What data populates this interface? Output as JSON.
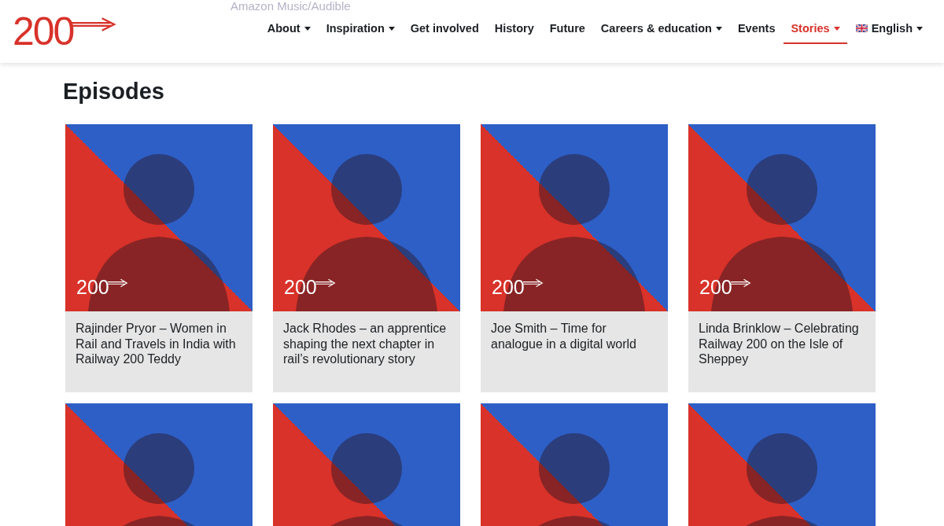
{
  "behind_header": {
    "label": "Amazon Music/Audible"
  },
  "logo": {
    "text": "200"
  },
  "nav": [
    {
      "label": "About",
      "dropdown": true,
      "selected": false,
      "kind": "link"
    },
    {
      "label": "Inspiration",
      "dropdown": true,
      "selected": false,
      "kind": "link"
    },
    {
      "label": "Get involved",
      "dropdown": false,
      "selected": false,
      "kind": "link"
    },
    {
      "label": "History",
      "dropdown": false,
      "selected": false,
      "kind": "link"
    },
    {
      "label": "Future",
      "dropdown": false,
      "selected": false,
      "kind": "link"
    },
    {
      "label": "Careers & education",
      "dropdown": true,
      "selected": false,
      "kind": "link"
    },
    {
      "label": "Events",
      "dropdown": false,
      "selected": false,
      "kind": "link"
    },
    {
      "label": "Stories",
      "dropdown": true,
      "selected": true,
      "kind": "link"
    },
    {
      "label": "English",
      "dropdown": true,
      "selected": false,
      "kind": "language"
    }
  ],
  "heading": "Episodes",
  "episodes": [
    {
      "kind": "titled",
      "badge": "200",
      "title": "Rajinder Pryor – Women in Rail and Travels in India with Railway 200 Teddy"
    },
    {
      "kind": "titled",
      "badge": "200",
      "title": "Jack Rhodes – an apprentice shaping the next chapter in rail’s revolutionary story"
    },
    {
      "kind": "titled",
      "badge": "200",
      "title": "Joe Smith – Time for analogue in a digital world"
    },
    {
      "kind": "titled",
      "badge": "200",
      "title": "Linda Brinklow – Celebrating Railway 200 on the Isle of Sheppey"
    },
    {
      "kind": "image_only"
    },
    {
      "kind": "image_only"
    },
    {
      "kind": "image_only"
    },
    {
      "kind": "image_only"
    }
  ]
}
